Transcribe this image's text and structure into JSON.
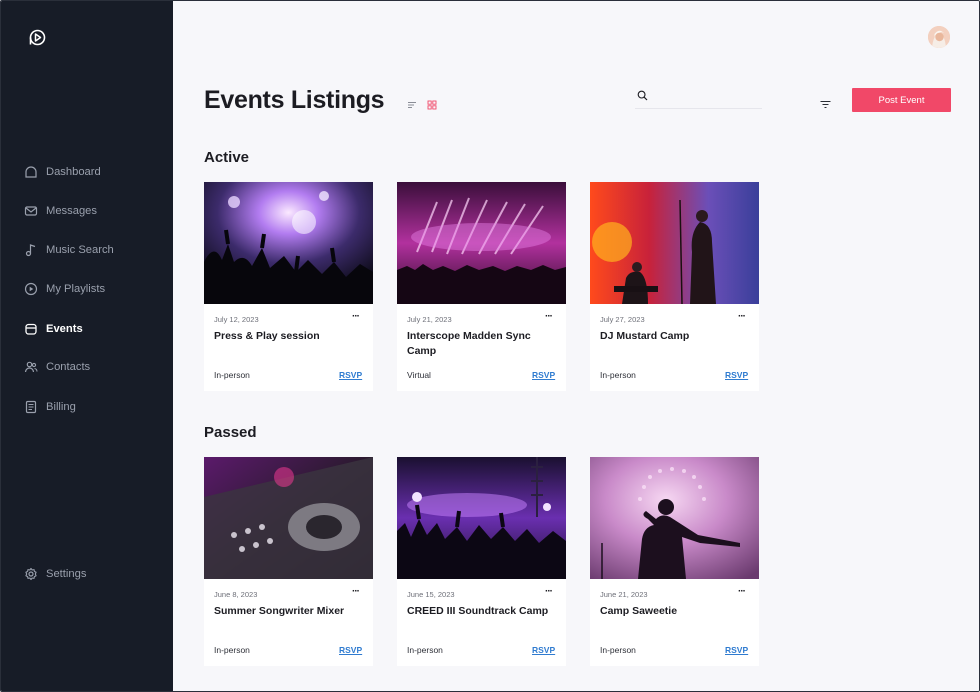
{
  "sidebar": {
    "items": [
      {
        "label": "Dashboard",
        "icon": "dashboard-icon",
        "active": false
      },
      {
        "label": "Messages",
        "icon": "mail-icon",
        "active": false
      },
      {
        "label": "Music Search",
        "icon": "music-note-icon",
        "active": false
      },
      {
        "label": "My Playlists",
        "icon": "play-circle-icon",
        "active": false
      },
      {
        "label": "Events",
        "icon": "events-icon",
        "active": true
      },
      {
        "label": "Contacts",
        "icon": "contacts-icon",
        "active": false
      },
      {
        "label": "Billing",
        "icon": "billing-icon",
        "active": false
      }
    ],
    "settings_label": "Settings"
  },
  "header": {
    "title": "Events Listings",
    "search_placeholder": "",
    "post_button": "Post Event"
  },
  "colors": {
    "sidebar_bg": "#171c27",
    "accent": "#f14868",
    "link": "#2f7bd0"
  },
  "sections": {
    "active": {
      "title": "Active",
      "events": [
        {
          "date": "July 12, 2023",
          "title": "Press & Play session",
          "type": "In-person",
          "rsvp": "RSVP",
          "more": "···"
        },
        {
          "date": "July 21, 2023",
          "title": "Interscope Madden Sync Camp",
          "type": "Virtual",
          "rsvp": "RSVP",
          "more": "···"
        },
        {
          "date": "July 27, 2023",
          "title": "DJ Mustard Camp",
          "type": "In-person",
          "rsvp": "RSVP",
          "more": "···"
        }
      ]
    },
    "passed": {
      "title": "Passed",
      "events": [
        {
          "date": "June 8, 2023",
          "title": "Summer Songwriter Mixer",
          "type": "In-person",
          "rsvp": "RSVP",
          "more": "···"
        },
        {
          "date": "June 15, 2023",
          "title": "CREED III Soundtrack Camp",
          "type": "In-person",
          "rsvp": "RSVP",
          "more": "···"
        },
        {
          "date": "June 21, 2023",
          "title": "Camp Saweetie",
          "type": "In-person",
          "rsvp": "RSVP",
          "more": "···"
        }
      ]
    }
  }
}
